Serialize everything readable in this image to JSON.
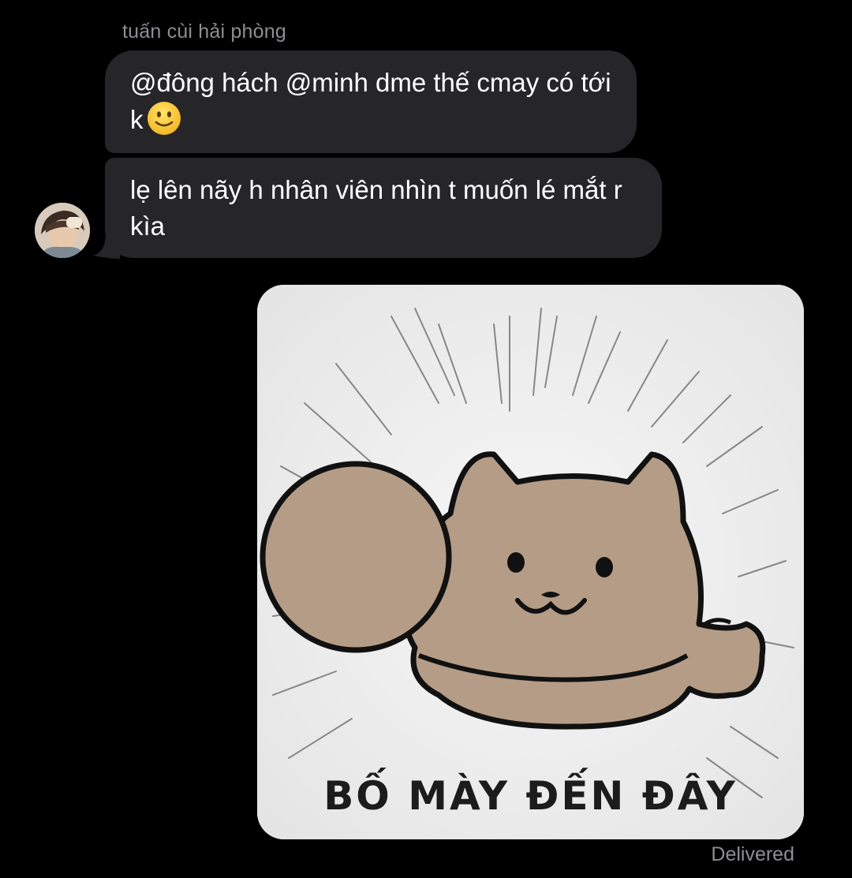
{
  "conversation": {
    "sender_name": "tuấn cùi hải phòng",
    "messages": [
      {
        "from": "tuấn cùi hải phòng",
        "text": "@đông hách @minh dme thế cmay có tới k",
        "emoji": "slightly-smiling-face"
      },
      {
        "from": "tuấn cùi hải phòng",
        "text": "lẹ lên nãy h nhân viên nhìn t muốn lé mắt r kìa"
      },
      {
        "from": "me",
        "type": "image",
        "caption": "BỐ MÀY ĐẾN ĐÂY"
      }
    ],
    "delivery_status": "Delivered"
  },
  "colors": {
    "background": "#000000",
    "incoming_bubble": "#262629",
    "secondary_text": "#8e8e93",
    "cat_fill": "#b59c87"
  }
}
